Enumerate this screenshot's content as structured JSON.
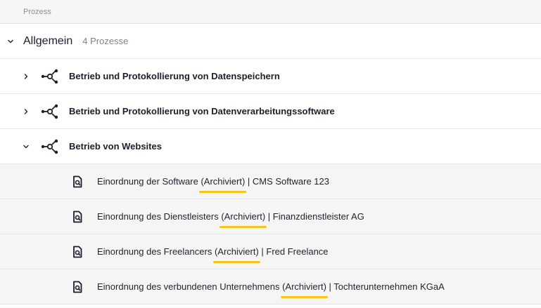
{
  "table": {
    "column_header": "Prozess"
  },
  "group": {
    "title": "Allgemein",
    "count": "4 Prozesse"
  },
  "processes": [
    {
      "title": "Betrieb und Protokollierung von Datenspeichern",
      "expanded": false
    },
    {
      "title": "Betrieb und Protokollierung von Datenverarbeitungssoftware",
      "expanded": false
    },
    {
      "title": "Betrieb von Websites",
      "expanded": true
    }
  ],
  "documents": [
    {
      "prefix": "Einordnung der Software ",
      "status": "(Archiviert)",
      "suffix": " | CMS Software 123"
    },
    {
      "prefix": "Einordnung des Dienstleisters ",
      "status": "(Archiviert)",
      "suffix": " | Finanzdienstleister AG"
    },
    {
      "prefix": "Einordnung des Freelancers ",
      "status": "(Archiviert)",
      "suffix": " | Fred Freelance"
    },
    {
      "prefix": "Einordnung des verbundenen Unternehmens ",
      "status": "(Archiviert)",
      "suffix": " | Tochterunternehmen KGaA"
    }
  ],
  "icons": {
    "chevron_down": "chevron-down-icon",
    "chevron_right": "chevron-right-icon",
    "process": "process-network-icon",
    "document": "document-search-icon"
  },
  "colors": {
    "highlight": "#f5c518",
    "text": "#1c1f2a",
    "muted": "#7e818a"
  }
}
